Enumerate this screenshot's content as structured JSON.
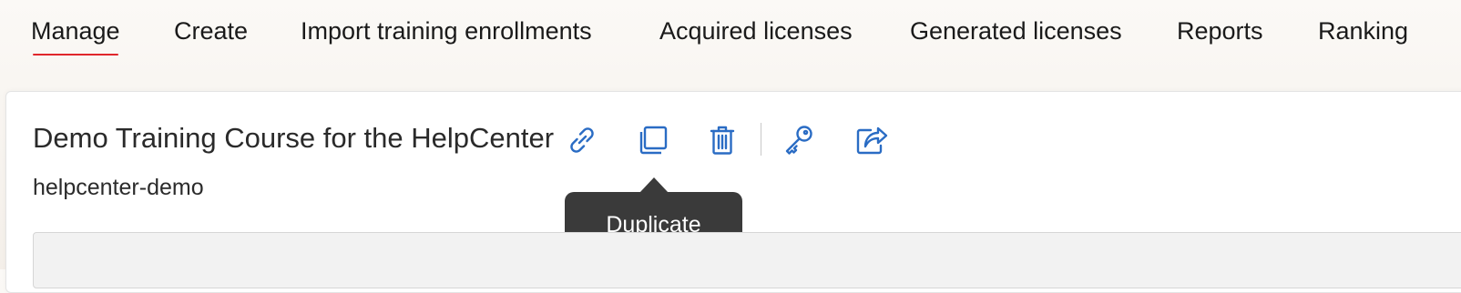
{
  "nav": {
    "tabs": [
      {
        "label": "Manage",
        "active": true
      },
      {
        "label": "Create"
      },
      {
        "label": "Import training enrollments"
      },
      {
        "label": "Acquired licenses"
      },
      {
        "label": "Generated licenses"
      },
      {
        "label": "Reports"
      },
      {
        "label": "Ranking"
      }
    ],
    "active_underline_color": "#e0262b"
  },
  "course": {
    "title": "Demo Training Course for the HelpCenter",
    "slug": "helpcenter-demo"
  },
  "actions": [
    {
      "icon": "link-icon"
    },
    {
      "icon": "duplicate-icon"
    },
    {
      "icon": "trash-icon"
    },
    {
      "icon": "key-icon"
    },
    {
      "icon": "share-icon"
    }
  ],
  "icon_color": "#2a6cc4",
  "tooltip": {
    "text": "Duplicate"
  }
}
